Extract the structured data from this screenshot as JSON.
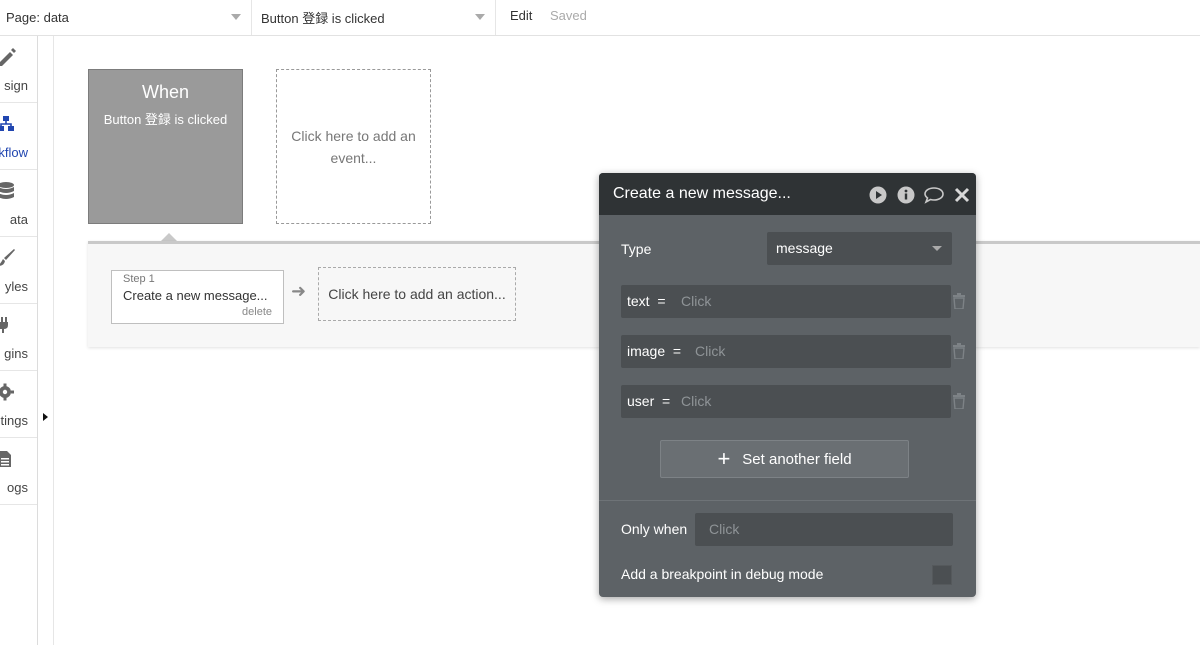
{
  "topbar": {
    "page_select": "Page: data",
    "event_select": "Button 登録 is clicked",
    "edit_label": "Edit",
    "saved_label": "Saved"
  },
  "sidebar": {
    "items": [
      {
        "label": "sign",
        "icon": "pencil-ruler-icon"
      },
      {
        "label": "kflow",
        "icon": "workflow-icon",
        "active": true
      },
      {
        "label": "ata",
        "icon": "database-icon"
      },
      {
        "label": "yles",
        "icon": "brush-icon"
      },
      {
        "label": "gins",
        "icon": "plug-icon"
      },
      {
        "label": "tings",
        "icon": "gear-icon"
      },
      {
        "label": "ogs",
        "icon": "document-icon"
      }
    ],
    "active_color": "#2146b0"
  },
  "workflow": {
    "when_title": "When",
    "when_subtitle": "Button 登録 is clicked",
    "add_event": "Click here to add an event...",
    "step": {
      "number_label": "Step 1",
      "title": "Create a new message...",
      "delete_label": "delete"
    },
    "add_action": "Click here to add an action..."
  },
  "panel": {
    "title": "Create a new message...",
    "header_icons": [
      "play-icon",
      "info-icon",
      "comment-icon",
      "close-icon"
    ],
    "type_label": "Type",
    "type_value": "message",
    "fields": [
      {
        "name": "text",
        "eq": "=",
        "value": "Click"
      },
      {
        "name": "image",
        "eq": "=",
        "value": "Click"
      },
      {
        "name": "user",
        "eq": "=",
        "value": "Click"
      }
    ],
    "set_field_button": "Set another field",
    "only_when_label": "Only when",
    "only_when_value": "Click",
    "breakpoint_label": "Add a breakpoint in debug mode"
  }
}
